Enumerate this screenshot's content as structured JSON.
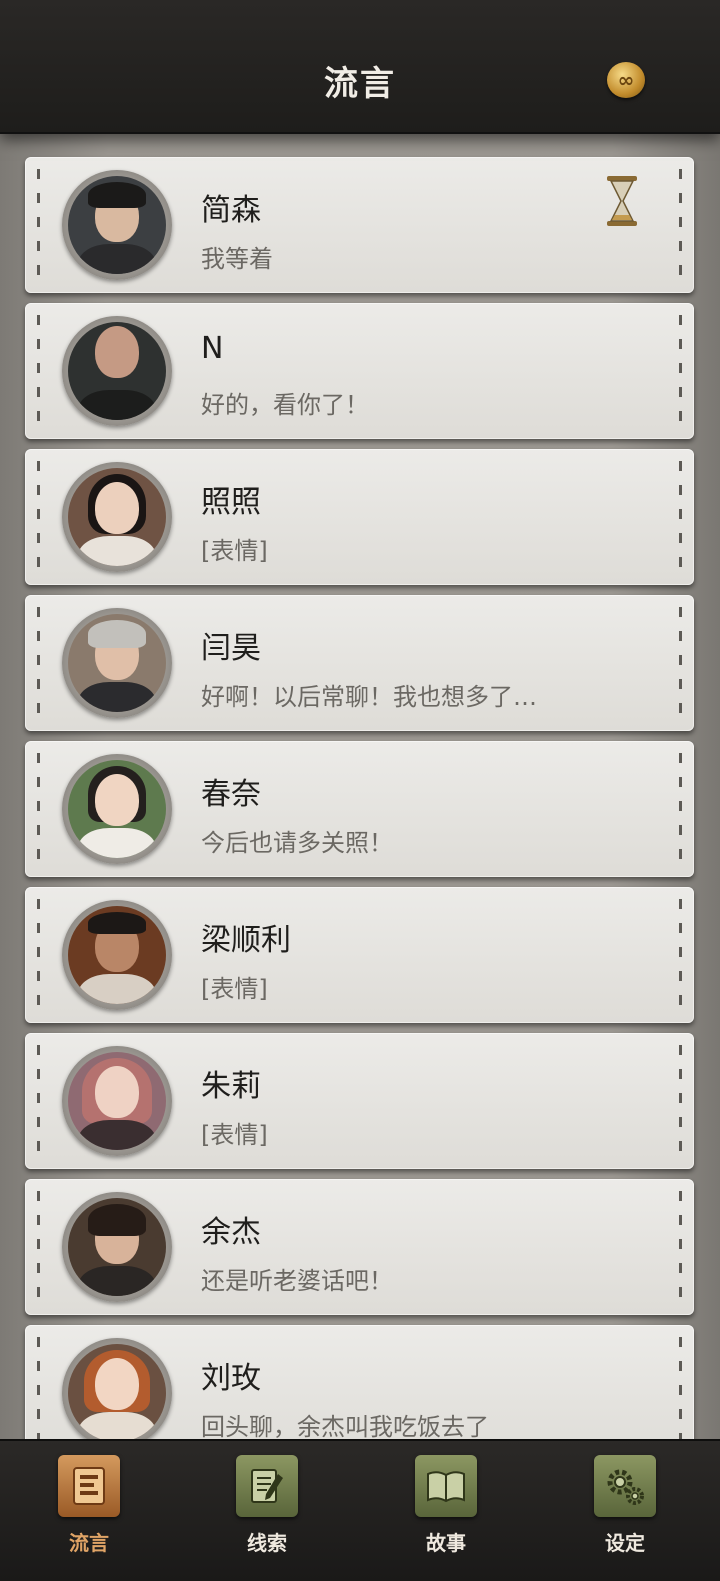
{
  "header": {
    "title": "流言",
    "coin_icon": "coin-icon",
    "coin_symbol": "∞"
  },
  "conversations": [
    {
      "name": "简森",
      "message": "我等着",
      "pending": true
    },
    {
      "name": "N",
      "message": "好的，看你了！"
    },
    {
      "name": "照照",
      "message": "[表情]"
    },
    {
      "name": "闫昊",
      "message": "好啊！以后常聊！我也想多了…"
    },
    {
      "name": "春奈",
      "message": "今后也请多关照！"
    },
    {
      "name": "梁顺利",
      "message": "[表情]"
    },
    {
      "name": "朱莉",
      "message": "[表情]"
    },
    {
      "name": "余杰",
      "message": "还是听老婆话吧！"
    },
    {
      "name": "刘玫",
      "message": "回头聊，余杰叫我吃饭去了"
    }
  ],
  "nav": {
    "items": [
      {
        "label": "流言",
        "icon": "message-list-icon",
        "active": true
      },
      {
        "label": "线索",
        "icon": "notepad-icon",
        "active": false
      },
      {
        "label": "故事",
        "icon": "book-icon",
        "active": false
      },
      {
        "label": "设定",
        "icon": "gear-icon",
        "active": false
      }
    ]
  },
  "colors": {
    "header_bg": "#1e1d1b",
    "card_bg": "#e6e4e0",
    "nav_active": "#c17f45",
    "nav_idle": "#7a8552"
  }
}
